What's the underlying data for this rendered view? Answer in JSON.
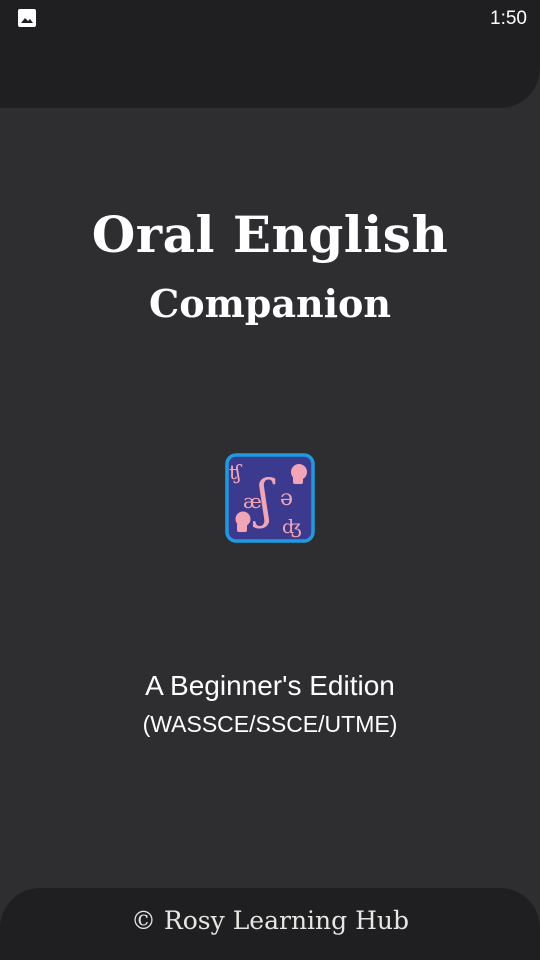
{
  "status_bar": {
    "notification_icon": "image-icon",
    "time": "1:50"
  },
  "splash": {
    "title_line1": "Oral English",
    "title_line2": "Companion",
    "logo": {
      "icon": "phonetics-logo-icon",
      "symbols": [
        "ʧ",
        "æ",
        "ʃ",
        "ə",
        "ʤ"
      ],
      "colors": {
        "border": "#1e9be0",
        "background": "#3b3a8f",
        "glyph": "#f2a5b4"
      }
    },
    "subtitle": "A Beginner's Edition",
    "exams": "(WASSCE/SSCE/UTME)"
  },
  "footer": {
    "credit": "© Rosy Learning Hub"
  },
  "colors": {
    "background": "#2e2d30",
    "bar": "#1f1e21",
    "text": "#ffffff"
  }
}
